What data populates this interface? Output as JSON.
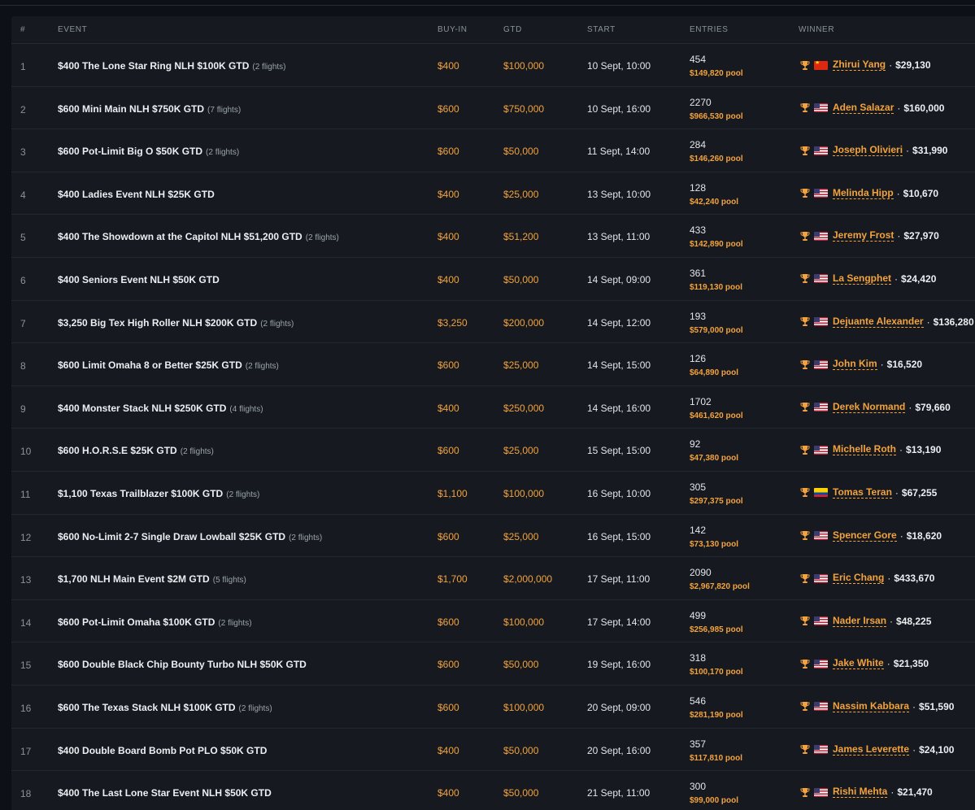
{
  "columns": {
    "num": "#",
    "event": "EVENT",
    "buyin": "BUY-IN",
    "gtd": "GTD",
    "start": "START",
    "entries": "ENTRIES",
    "winner": "WINNER"
  },
  "separator": "·",
  "colors": {
    "accent": "#f3a23c",
    "background": "#0d1117",
    "panel": "#161a20"
  },
  "icons": {
    "trophy": "trophy-icon"
  },
  "rows": [
    {
      "num": "1",
      "event": "$400 The Lone Star Ring NLH $100K GTD",
      "flights": "(2 flights)",
      "buyin": "$400",
      "gtd": "$100,000",
      "start": "10 Sept, 10:00",
      "entries": "454",
      "pool": "$149,820 pool",
      "flag": "cn",
      "winner": "Zhirui Yang",
      "prize": "$29,130"
    },
    {
      "num": "2",
      "event": "$600 Mini Main NLH $750K GTD",
      "flights": "(7 flights)",
      "buyin": "$600",
      "gtd": "$750,000",
      "start": "10 Sept, 16:00",
      "entries": "2270",
      "pool": "$966,530 pool",
      "flag": "us",
      "winner": "Aden Salazar",
      "prize": "$160,000"
    },
    {
      "num": "3",
      "event": "$600 Pot-Limit Big O $50K GTD",
      "flights": "(2 flights)",
      "buyin": "$600",
      "gtd": "$50,000",
      "start": "11 Sept, 14:00",
      "entries": "284",
      "pool": "$146,260 pool",
      "flag": "us",
      "winner": "Joseph Olivieri",
      "prize": "$31,990"
    },
    {
      "num": "4",
      "event": "$400 Ladies Event NLH $25K GTD",
      "flights": "",
      "buyin": "$400",
      "gtd": "$25,000",
      "start": "13 Sept, 10:00",
      "entries": "128",
      "pool": "$42,240 pool",
      "flag": "us",
      "winner": "Melinda Hipp",
      "prize": "$10,670"
    },
    {
      "num": "5",
      "event": "$400 The Showdown at the Capitol NLH $51,200 GTD",
      "flights": "(2 flights)",
      "buyin": "$400",
      "gtd": "$51,200",
      "start": "13 Sept, 11:00",
      "entries": "433",
      "pool": "$142,890 pool",
      "flag": "us",
      "winner": "Jeremy Frost",
      "prize": "$27,970"
    },
    {
      "num": "6",
      "event": "$400 Seniors Event NLH $50K GTD",
      "flights": "",
      "buyin": "$400",
      "gtd": "$50,000",
      "start": "14 Sept, 09:00",
      "entries": "361",
      "pool": "$119,130 pool",
      "flag": "us",
      "winner": "La Sengphet",
      "prize": "$24,420"
    },
    {
      "num": "7",
      "event": "$3,250 Big Tex High Roller NLH $200K GTD",
      "flights": "(2 flights)",
      "buyin": "$3,250",
      "gtd": "$200,000",
      "start": "14 Sept, 12:00",
      "entries": "193",
      "pool": "$579,000 pool",
      "flag": "us",
      "winner": "Dejuante Alexander",
      "prize": "$136,280"
    },
    {
      "num": "8",
      "event": "$600 Limit Omaha 8 or Better $25K GTD",
      "flights": "(2 flights)",
      "buyin": "$600",
      "gtd": "$25,000",
      "start": "14 Sept, 15:00",
      "entries": "126",
      "pool": "$64,890 pool",
      "flag": "us",
      "winner": "John Kim",
      "prize": "$16,520"
    },
    {
      "num": "9",
      "event": "$400 Monster Stack NLH $250K GTD",
      "flights": "(4 flights)",
      "buyin": "$400",
      "gtd": "$250,000",
      "start": "14 Sept, 16:00",
      "entries": "1702",
      "pool": "$461,620 pool",
      "flag": "us",
      "winner": "Derek Normand",
      "prize": "$79,660"
    },
    {
      "num": "10",
      "event": "$600 H.O.R.S.E $25K GTD",
      "flights": "(2 flights)",
      "buyin": "$600",
      "gtd": "$25,000",
      "start": "15 Sept, 15:00",
      "entries": "92",
      "pool": "$47,380 pool",
      "flag": "us",
      "winner": "Michelle Roth",
      "prize": "$13,190"
    },
    {
      "num": "11",
      "event": "$1,100 Texas Trailblazer $100K GTD",
      "flights": "(2 flights)",
      "buyin": "$1,100",
      "gtd": "$100,000",
      "start": "16 Sept, 10:00",
      "entries": "305",
      "pool": "$297,375 pool",
      "flag": "ec",
      "winner": "Tomas Teran",
      "prize": "$67,255"
    },
    {
      "num": "12",
      "event": "$600 No-Limit 2-7 Single Draw Lowball $25K GTD",
      "flights": "(2 flights)",
      "buyin": "$600",
      "gtd": "$25,000",
      "start": "16 Sept, 15:00",
      "entries": "142",
      "pool": "$73,130 pool",
      "flag": "us",
      "winner": "Spencer Gore",
      "prize": "$18,620"
    },
    {
      "num": "13",
      "event": "$1,700 NLH Main Event $2M GTD",
      "flights": "(5 flights)",
      "buyin": "$1,700",
      "gtd": "$2,000,000",
      "start": "17 Sept, 11:00",
      "entries": "2090",
      "pool": "$2,967,820 pool",
      "flag": "us",
      "winner": "Eric Chang",
      "prize": "$433,670"
    },
    {
      "num": "14",
      "event": "$600 Pot-Limit Omaha $100K GTD",
      "flights": "(2 flights)",
      "buyin": "$600",
      "gtd": "$100,000",
      "start": "17 Sept, 14:00",
      "entries": "499",
      "pool": "$256,985 pool",
      "flag": "us",
      "winner": "Nader Irsan",
      "prize": "$48,225"
    },
    {
      "num": "15",
      "event": "$600 Double Black Chip Bounty Turbo NLH $50K GTD",
      "flights": "",
      "buyin": "$600",
      "gtd": "$50,000",
      "start": "19 Sept, 16:00",
      "entries": "318",
      "pool": "$100,170 pool",
      "flag": "us",
      "winner": "Jake White",
      "prize": "$21,350"
    },
    {
      "num": "16",
      "event": "$600 The Texas Stack NLH $100K GTD",
      "flights": "(2 flights)",
      "buyin": "$600",
      "gtd": "$100,000",
      "start": "20 Sept, 09:00",
      "entries": "546",
      "pool": "$281,190 pool",
      "flag": "us",
      "winner": "Nassim Kabbara",
      "prize": "$51,590"
    },
    {
      "num": "17",
      "event": "$400 Double Board Bomb Pot PLO $50K GTD",
      "flights": "",
      "buyin": "$400",
      "gtd": "$50,000",
      "start": "20 Sept, 16:00",
      "entries": "357",
      "pool": "$117,810 pool",
      "flag": "us",
      "winner": "James Leverette",
      "prize": "$24,100"
    },
    {
      "num": "18",
      "event": "$400 The Last Lone Star Event NLH $50K GTD",
      "flights": "",
      "buyin": "$400",
      "gtd": "$50,000",
      "start": "21 Sept, 11:00",
      "entries": "300",
      "pool": "$99,000 pool",
      "flag": "us",
      "winner": "Rishi Mehta",
      "prize": "$21,470"
    }
  ]
}
